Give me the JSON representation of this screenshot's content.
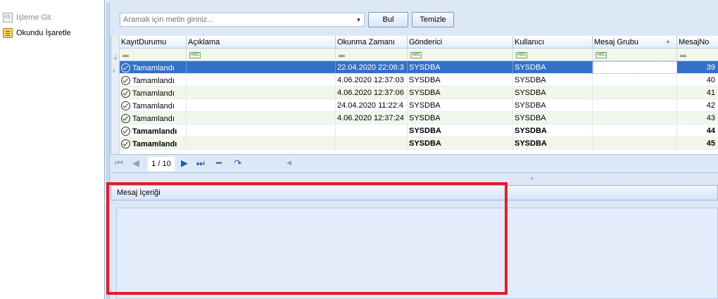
{
  "left_panel": {
    "items": [
      {
        "label": "İşleme Git",
        "icon": "goto-icon",
        "enabled": false
      },
      {
        "label": "Okundu İşaretle",
        "icon": "clipboard-icon",
        "enabled": true
      }
    ]
  },
  "search": {
    "placeholder": "Aramak için metin giriniz...",
    "find_label": "Bul",
    "clear_label": "Temizle"
  },
  "grid": {
    "columns": [
      "KayıtDurumu",
      "Açıklama",
      "Okunma Zamanı",
      "Gönderici",
      "Kullanıcı",
      "Mesaj Grubu",
      "MesajNo"
    ],
    "rows": [
      {
        "status": "Tamamlandı",
        "description": "",
        "read_time": "22.04.2020 22:06:3",
        "sender": "SYSDBA",
        "user": "SYSDBA",
        "group": "",
        "no": "39",
        "selected": true,
        "bold": false
      },
      {
        "status": "Tamamlandı",
        "description": "",
        "read_time": "4.06.2020 12:37:03",
        "sender": "SYSDBA",
        "user": "SYSDBA",
        "group": "",
        "no": "40",
        "selected": false,
        "bold": false
      },
      {
        "status": "Tamamlandı",
        "description": "",
        "read_time": "4.06.2020 12:37:06",
        "sender": "SYSDBA",
        "user": "SYSDBA",
        "group": "",
        "no": "41",
        "selected": false,
        "bold": false
      },
      {
        "status": "Tamamlandı",
        "description": "",
        "read_time": "24.04.2020 11:22:4",
        "sender": "SYSDBA",
        "user": "SYSDBA",
        "group": "",
        "no": "42",
        "selected": false,
        "bold": false
      },
      {
        "status": "Tamamlandı",
        "description": "",
        "read_time": "4.06.2020 12:37:24",
        "sender": "SYSDBA",
        "user": "SYSDBA",
        "group": "",
        "no": "43",
        "selected": false,
        "bold": false
      },
      {
        "status": "Tamamlandı",
        "description": "",
        "read_time": "",
        "sender": "SYSDBA",
        "user": "SYSDBA",
        "group": "",
        "no": "44",
        "selected": false,
        "bold": true
      },
      {
        "status": "Tamamlandı",
        "description": "",
        "read_time": "",
        "sender": "SYSDBA",
        "user": "SYSDBA",
        "group": "",
        "no": "45",
        "selected": false,
        "bold": true
      }
    ]
  },
  "navigator": {
    "page_text": "1 / 10"
  },
  "detail": {
    "title": "Mesaj İçeriği",
    "content": ""
  },
  "colors": {
    "selection": "#3370c8",
    "highlight": "#e01e2a",
    "panel_bg": "#dde8f7"
  }
}
